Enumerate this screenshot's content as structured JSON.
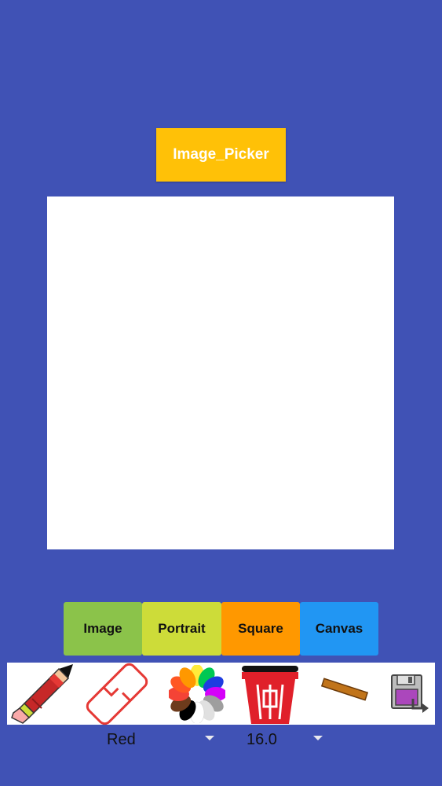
{
  "image_picker": {
    "label": "Image_Picker"
  },
  "mode_buttons": [
    {
      "label": "Image",
      "color": "#8BC34A"
    },
    {
      "label": "Portrait",
      "color": "#CDDC39"
    },
    {
      "label": "Square",
      "color": "#FF9800"
    },
    {
      "label": "Canvas",
      "color": "#2196F3"
    }
  ],
  "toolbar": {
    "tools": [
      {
        "icon": "pencil-icon"
      },
      {
        "icon": "eraser-icon"
      },
      {
        "icon": "color-wheel-icon"
      },
      {
        "icon": "trash-icon"
      },
      {
        "icon": "stick-icon"
      },
      {
        "icon": "save-icon"
      }
    ]
  },
  "color_select": {
    "value": "Red"
  },
  "size_select": {
    "value": "16.0"
  },
  "colors": {
    "background": "#4052B5",
    "picker_button": "#FFC107",
    "canvas": "#FFFFFF"
  }
}
